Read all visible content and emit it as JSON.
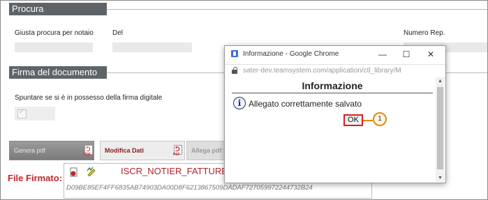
{
  "sections": {
    "procura": {
      "title": "Procura",
      "labels": {
        "notaio": "Giusta procura per notaio",
        "del": "Del",
        "numero_rep": "Numero Rep."
      }
    },
    "firma": {
      "title": "Firma del documento",
      "checkbox_label": "Spuntare se si è in possesso della firma digitale"
    }
  },
  "buttons": {
    "genera_pdf": "Genera pdf",
    "modifica_dati": "Modifica Dati",
    "allega_pdf": "Allega pdf fir",
    "pdf_tag": "PDF"
  },
  "file": {
    "label": "File Firmato:",
    "name": "ISCR_NOTIER_FATTURE_1",
    "hash": "D09BE85EF4FF6835AB74903DA00D8F6213867509DADAF727059972244732B24"
  },
  "popup": {
    "window_title": "Informazione - Google Chrome",
    "url": "sater-dev.teamsystem.com/application/ctl_library/M",
    "heading": "Informazione",
    "message": "Allegato correttamente salvato",
    "ok_label": "OK",
    "callout_number": "1",
    "controls": {
      "minimize": "—",
      "maximize": "☐",
      "close": "✕"
    }
  },
  "colors": {
    "section_header_bg": "#5e6468",
    "accent_red": "#c0262b",
    "callout_orange": "#e08a12"
  }
}
